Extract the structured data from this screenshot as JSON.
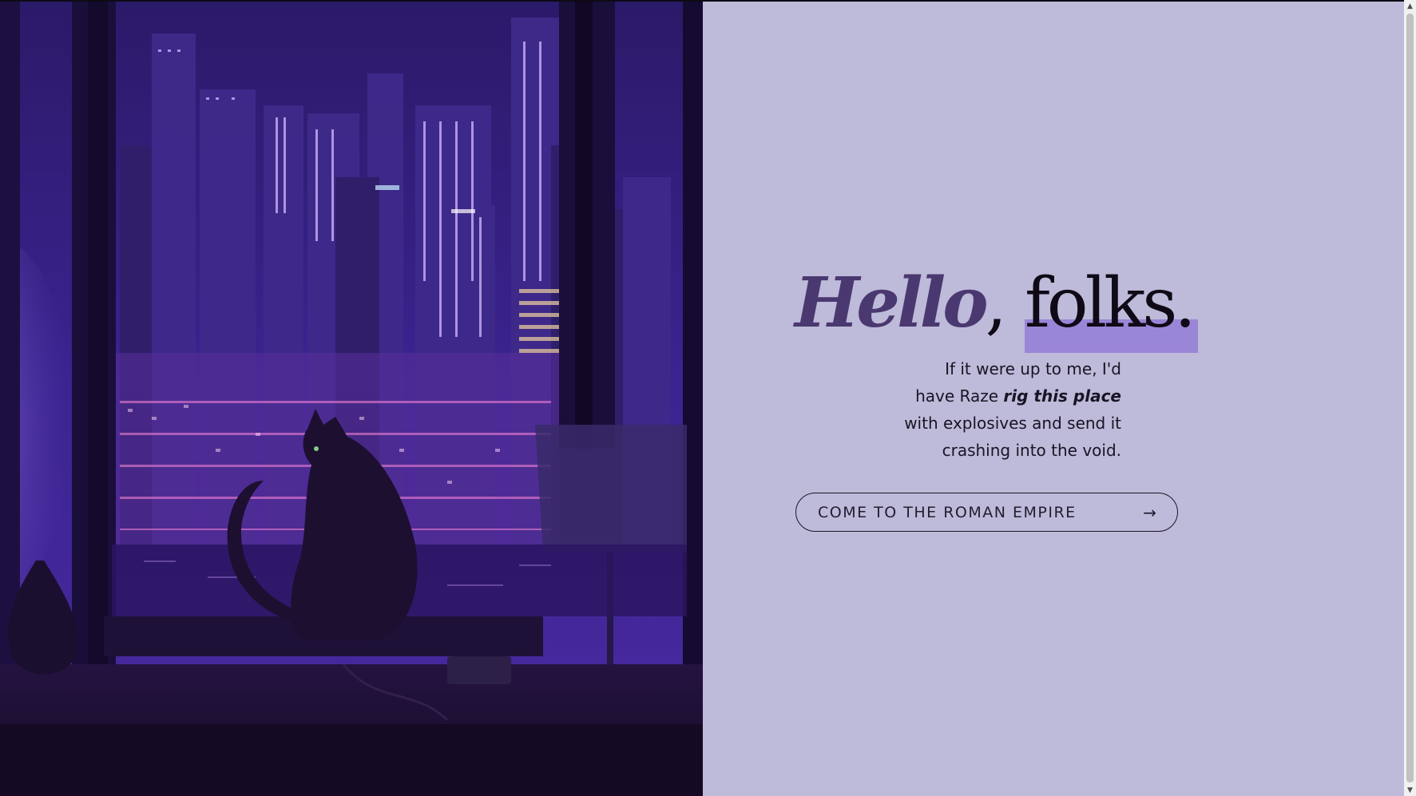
{
  "hero": {
    "image_icon": "night-city-cat-illustration",
    "headline": {
      "hello": "Hello",
      "comma": ",",
      "folks": "folks."
    },
    "tagline": {
      "before": "If it were up to me, I'd have Raze ",
      "emphasis": "rig this place",
      "after": " with explosives and send it crashing into the void."
    },
    "cta": {
      "label": "COME TO THE ROMAN EMPIRE",
      "arrow": "→"
    }
  },
  "colors": {
    "content_background": "#bebad9",
    "hello_color": "#4a3870",
    "highlight": "#9a86d6",
    "text": "#0f0a16"
  },
  "scrollbar": {
    "up_arrow": "▲",
    "down_arrow": "▼"
  }
}
